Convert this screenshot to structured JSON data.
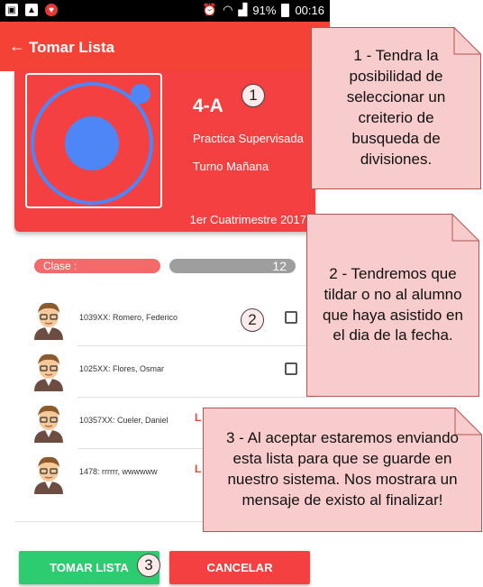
{
  "status_bar": {
    "battery": "91%",
    "time": "00:16"
  },
  "toolbar": {
    "back_icon": "arrow-left-icon",
    "title": "Tomar Lista"
  },
  "card": {
    "course": "4-A",
    "subject": "Practica Supervisada",
    "shift": "Turno Mañana",
    "term": "1er Cuatrimestre 2017"
  },
  "class_bar": {
    "label": "Clase :",
    "count": "12"
  },
  "students": [
    {
      "name": "1039XX: Romero, Federico",
      "checked": false
    },
    {
      "name": "1025XX: Flores, Osmar",
      "checked": false
    },
    {
      "name": "10357XX: Cueler, Daniel",
      "checked": false,
      "status": "L"
    },
    {
      "name": "1478: rrrrrr, wwwwww",
      "checked": false,
      "status": "L"
    }
  ],
  "buttons": {
    "accept": "TOMAR LISTA",
    "cancel": "CANCELAR"
  },
  "markers": {
    "m1": "1",
    "m2": "2",
    "m3": "3"
  },
  "notes": {
    "n1": "1 - Tendra la\nposibilidad de\nseleccionar un\ncreiterio de\nbusqueda de\ndivisiones.",
    "n2": "2 - Tendremos que\ntildar o no al alumno\nque haya asistido en\nel dia de la fecha.",
    "n3": "3 - Al aceptar estaremos enviando\nesta lista para que se guarde en\nnuestro sistema. Nos mostrara un\nmensaje de existo al finalizar!"
  },
  "colors": {
    "primary": "#f44336",
    "accept": "#2ecc71",
    "note_fill": "#f8cccc",
    "note_border": "#b85450",
    "logo_blue": "#4f86f7"
  }
}
